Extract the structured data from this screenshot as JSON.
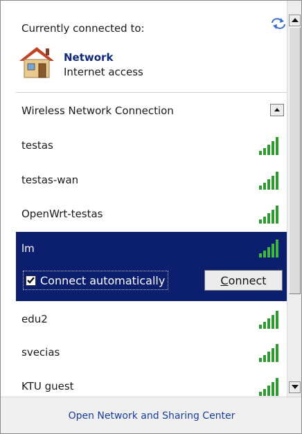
{
  "header": {
    "title": "Currently connected to:",
    "refresh_icon": "refresh-icon"
  },
  "connected_network": {
    "name": "Network",
    "status": "Internet access",
    "icon": "house-icon"
  },
  "wireless_section": {
    "label": "Wireless Network Connection",
    "collapse_icon": "collapse-icon"
  },
  "networks": [
    {
      "name": "testas",
      "signal_bars": 5
    },
    {
      "name": "testas-wan",
      "signal_bars": 5
    },
    {
      "name": "OpenWrt-testas",
      "signal_bars": 5
    },
    {
      "name": "lm",
      "signal_bars": 5,
      "selected": true
    },
    {
      "name": "edu2",
      "signal_bars": 5
    },
    {
      "name": "svecias",
      "signal_bars": 5
    },
    {
      "name": "KTU guest",
      "signal_bars": 5
    }
  ],
  "selected_network": {
    "connect_automatically_label": "Connect automatically",
    "connect_automatically_checked": true,
    "connect_button_label": "Connect",
    "connect_button_mnemonic": "C",
    "connect_button_rest": "onnect"
  },
  "footer": {
    "link_label": "Open Network and Sharing Center"
  },
  "colors": {
    "selection_bg": "#0c1f6e",
    "link": "#1a3c9c",
    "network_name": "#10297a",
    "signal_green": "#2f9a2f"
  }
}
